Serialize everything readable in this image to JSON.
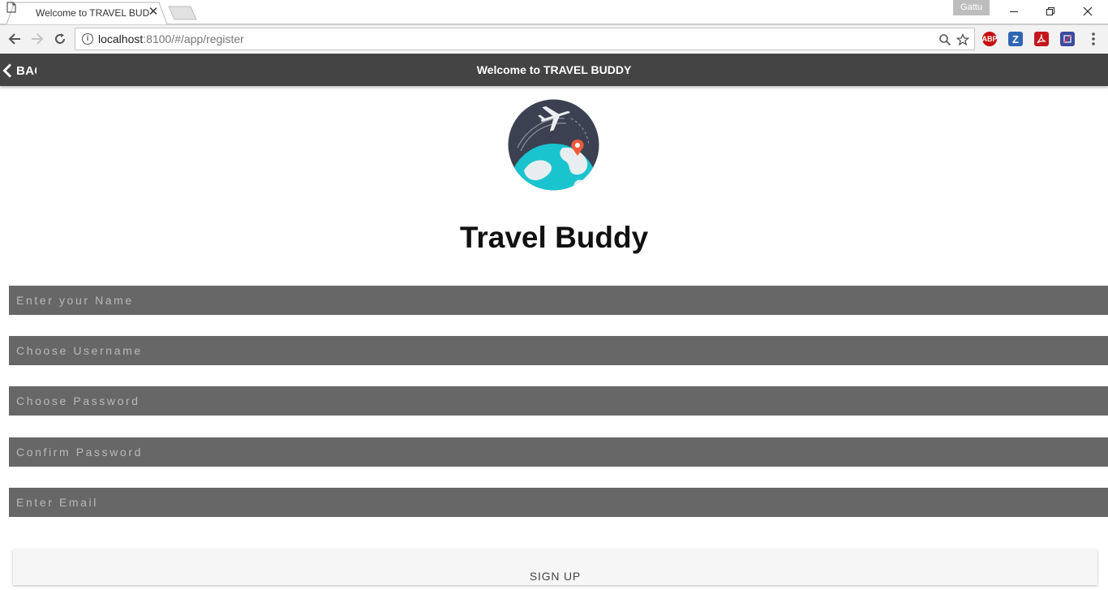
{
  "browser": {
    "tab_title": "Welcome to TRAVEL BUDD",
    "tab_close": "✕",
    "profile_name": "Gattu",
    "url_host": "localhost",
    "url_path": ":8100/#/app/register",
    "extensions": [
      {
        "name": "adblock-plus",
        "label": "ABP",
        "color": "#c70d0d"
      },
      {
        "name": "zotero",
        "label": "Z",
        "color": "#2f66b3"
      },
      {
        "name": "adobe-acrobat",
        "label": "",
        "color": "#c4161c"
      },
      {
        "name": "extension",
        "label": "",
        "color": "#3c4a9c"
      }
    ]
  },
  "header": {
    "back_label": "BACK",
    "title": "Welcome to TRAVEL BUDDY",
    "bar_color": "#444444"
  },
  "main": {
    "brand_title": "Travel Buddy",
    "fields": [
      {
        "name": "name-input",
        "placeholder": "Enter your Name",
        "value": ""
      },
      {
        "name": "username-input",
        "placeholder": "Choose Username",
        "value": ""
      },
      {
        "name": "password-input",
        "placeholder": "Choose Password",
        "value": ""
      },
      {
        "name": "confirm-password-input",
        "placeholder": "Confirm Password",
        "value": ""
      },
      {
        "name": "email-input",
        "placeholder": "Enter Email",
        "value": ""
      }
    ],
    "signup_label": "SIGN UP"
  }
}
